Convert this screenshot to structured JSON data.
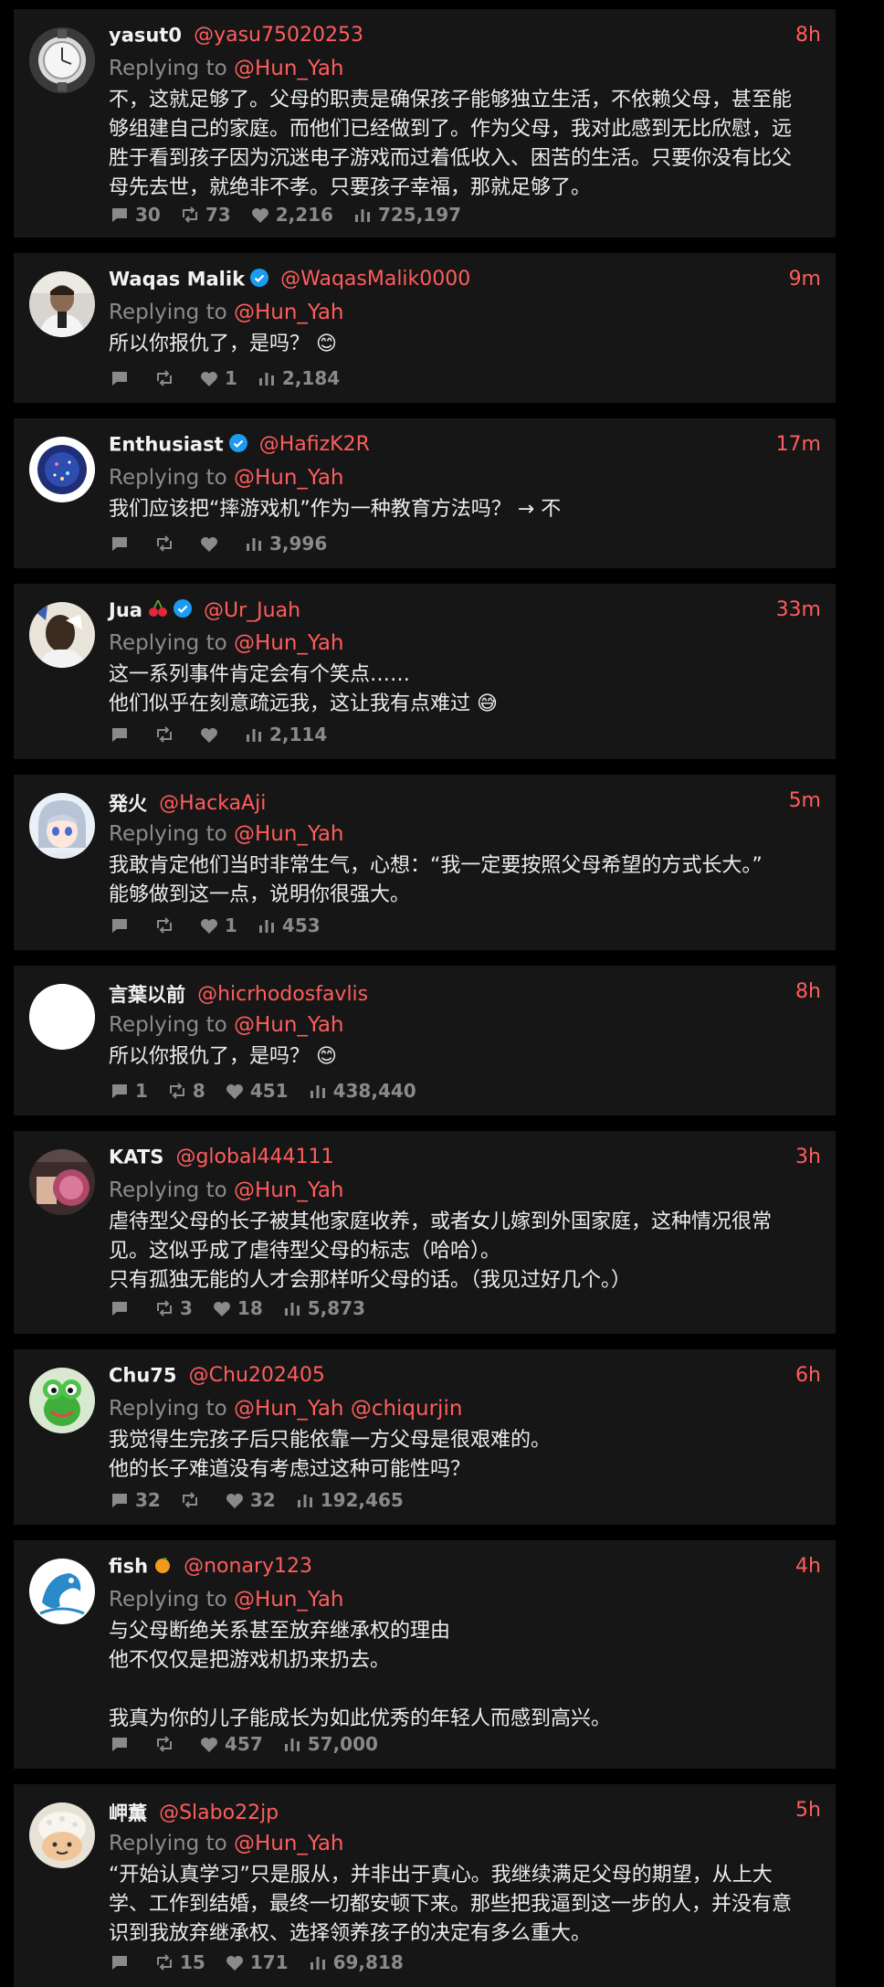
{
  "replies": [
    {
      "name": "yasut0",
      "handle": "@yasu75020253",
      "time": "8h",
      "replying": "Replying to",
      "mentions": [
        "@Hun_Yah"
      ],
      "lines": [
        "不，这就足够了。父母的职责是确保孩子能够独立生活，不依赖父母，甚至能",
        "够组建自己的家庭。而他们已经做到了。作为父母，我对此感到无比欣慰，远",
        "胜于看到孩子因为沉迷电子游戏而过着低收入、困苦的生活。只要你没有比父",
        "母先去世，就绝非不孝。只要孩子幸福，那就足够了。"
      ],
      "comments": "30",
      "retweets": "73",
      "likes": "2,216",
      "views": "725,197"
    },
    {
      "name": "Waqas Malik",
      "handle": "@WaqasMalik0000",
      "time": "9m",
      "replying": "Replying to",
      "mentions": [
        "@Hun_Yah"
      ],
      "lines": [
        "所以你报仇了，是吗？ 😊"
      ],
      "comments": "",
      "retweets": "",
      "likes": "1",
      "views": "2,184"
    },
    {
      "name": "Enthusiast",
      "handle": "@HafizK2R",
      "time": "17m",
      "replying": "Replying to",
      "mentions": [
        "@Hun_Yah"
      ],
      "lines": [
        "我们应该把“摔游戏机”作为一种教育方法吗？ → 不"
      ],
      "comments": "",
      "retweets": "",
      "likes": "",
      "views": "3,996"
    },
    {
      "name": "Jua",
      "handle": "@Ur_Juah",
      "time": "33m",
      "replying": "Replying to",
      "mentions": [
        "@Hun_Yah"
      ],
      "lines": [
        "这一系列事件肯定会有个笑点……",
        "他们似乎在刻意疏远我，这让我有点难过 😅"
      ],
      "comments": "",
      "retweets": "",
      "likes": "",
      "views": "2,114"
    },
    {
      "name": "発火",
      "handle": "@HackaAji",
      "time": "5m",
      "replying": "Replying to",
      "mentions": [
        "@Hun_Yah"
      ],
      "lines": [
        "我敢肯定他们当时非常生气，心想：“我一定要按照父母希望的方式长大。”",
        "能够做到这一点，说明你很强大。"
      ],
      "comments": "",
      "retweets": "",
      "likes": "1",
      "views": "453"
    },
    {
      "name": "言葉以前",
      "handle": "@hicrhodosfavlis",
      "time": "8h",
      "replying": "Replying to",
      "mentions": [
        "@Hun_Yah"
      ],
      "lines": [
        "所以你报仇了，是吗？ 😊"
      ],
      "comments": "1",
      "retweets": "8",
      "likes": "451",
      "views": "438,440"
    },
    {
      "name": "KATS",
      "handle": "@global444111",
      "time": "3h",
      "replying": "Replying to",
      "mentions": [
        "@Hun_Yah"
      ],
      "lines": [
        "虐待型父母的长子被其他家庭收养，或者女儿嫁到外国家庭，这种情况很常",
        "见。这似乎成了虐待型父母的标志（哈哈）。",
        "只有孤独无能的人才会那样听父母的话。（我见过好几个。）"
      ],
      "comments": "",
      "retweets": "3",
      "likes": "18",
      "views": "5,873"
    },
    {
      "name": "Chu75",
      "handle": "@Chu202405",
      "time": "6h",
      "replying": "Replying to",
      "mentions": [
        "@Hun_Yah",
        "@chiqurjin"
      ],
      "lines": [
        "我觉得生完孩子后只能依靠一方父母是很艰难的。",
        "他的长子难道没有考虑过这种可能性吗？"
      ],
      "comments": "32",
      "retweets": "",
      "likes": "32",
      "views": "192,465"
    },
    {
      "name": "fish",
      "handle": "@nonary123",
      "time": "4h",
      "replying": "Replying to",
      "mentions": [
        "@Hun_Yah"
      ],
      "lines": [
        "与父母断绝关系甚至放弃继承权的理由",
        "他不仅仅是把游戏机扔来扔去。",
        "",
        "我真为你的儿子能成长为如此优秀的年轻人而感到高兴。"
      ],
      "comments": "",
      "retweets": "",
      "likes": "457",
      "views": "57,000"
    },
    {
      "name": "岬薫",
      "handle": "@Slabo22jp",
      "time": "5h",
      "replying": "Replying to",
      "mentions": [
        "@Hun_Yah"
      ],
      "lines": [
        "“开始认真学习”只是服从，并非出于真心。我继续满足父母的期望，从上大",
        "学、工作到结婚，最终一切都安顿下来。那些把我逼到这一步的人，并没有意",
        "识到我放弃继承权、选择领养孩子的决定有多么重大。"
      ],
      "comments": "",
      "retweets": "15",
      "likes": "171",
      "views": "69,818"
    }
  ]
}
